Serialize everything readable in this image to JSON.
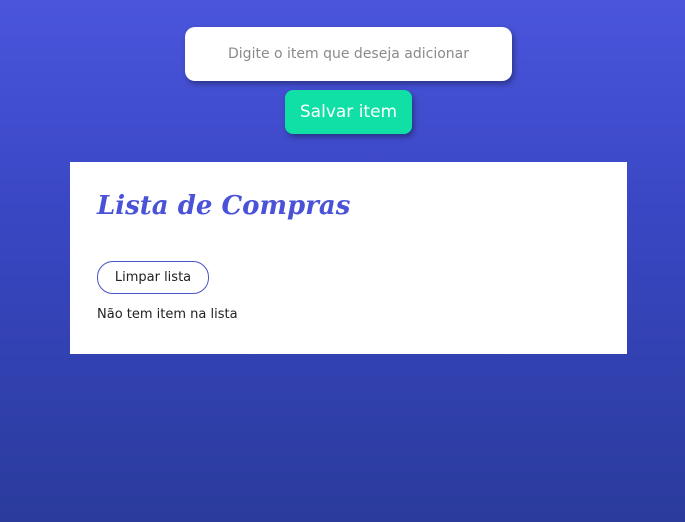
{
  "form": {
    "input_placeholder": "Digite o item que deseja adicionar",
    "input_value": "",
    "save_label": "Salvar item"
  },
  "list": {
    "title": "Lista de Compras",
    "clear_label": "Limpar lista",
    "empty_message": "Não tem item na lista"
  },
  "colors": {
    "background_top": "#4a55dc",
    "background_bottom": "#2a3b9c",
    "save_button": "#10e0a6",
    "title": "#4a52d8"
  }
}
